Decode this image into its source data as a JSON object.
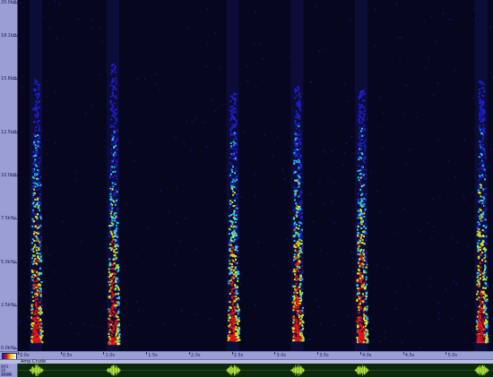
{
  "frequency_axis": {
    "labels": [
      {
        "text": "20.0kHz",
        "value": 20.0
      },
      {
        "text": "18.1kHz",
        "value": 18.1
      },
      {
        "text": "15.6kHz",
        "value": 15.6
      },
      {
        "text": "12.5kHz",
        "value": 12.5
      },
      {
        "text": "10.0kHz",
        "value": 10.0
      },
      {
        "text": "7.5kHz",
        "value": 7.5
      },
      {
        "text": "5.0kHz",
        "value": 5.0
      },
      {
        "text": "2.5kHz",
        "value": 2.5
      },
      {
        "text": "0.0kHz",
        "value": 0.0
      }
    ]
  },
  "time_axis": {
    "labels": [
      "0.0s",
      "0.5s",
      "1.0s",
      "1.5s",
      "2.0s",
      "2.5s",
      "3.0s",
      "3.5s",
      "4.0s",
      "4.5s",
      "5.0s"
    ]
  },
  "track": {
    "name": "Amp.Crude",
    "side_labels": [
      "MP3",
      "SR 22kHz",
      "16 bit"
    ]
  },
  "colors": {
    "background": "#06061f",
    "low": "#1d1dc8",
    "mid": "#23c8ff",
    "high": "#d8e61e",
    "peak": "#e0141c",
    "waveform": "#b8e83a"
  },
  "calls": [
    {
      "t": 0.2,
      "fmin": 0.4,
      "fmax": 15.8
    },
    {
      "t": 1.1,
      "fmin": 0.3,
      "fmax": 16.5
    },
    {
      "t": 2.5,
      "fmin": 0.5,
      "fmax": 14.8
    },
    {
      "t": 3.25,
      "fmin": 0.5,
      "fmax": 15.2
    },
    {
      "t": 4.0,
      "fmin": 0.4,
      "fmax": 15.0
    },
    {
      "t": 5.4,
      "fmin": 0.4,
      "fmax": 15.6
    }
  ]
}
